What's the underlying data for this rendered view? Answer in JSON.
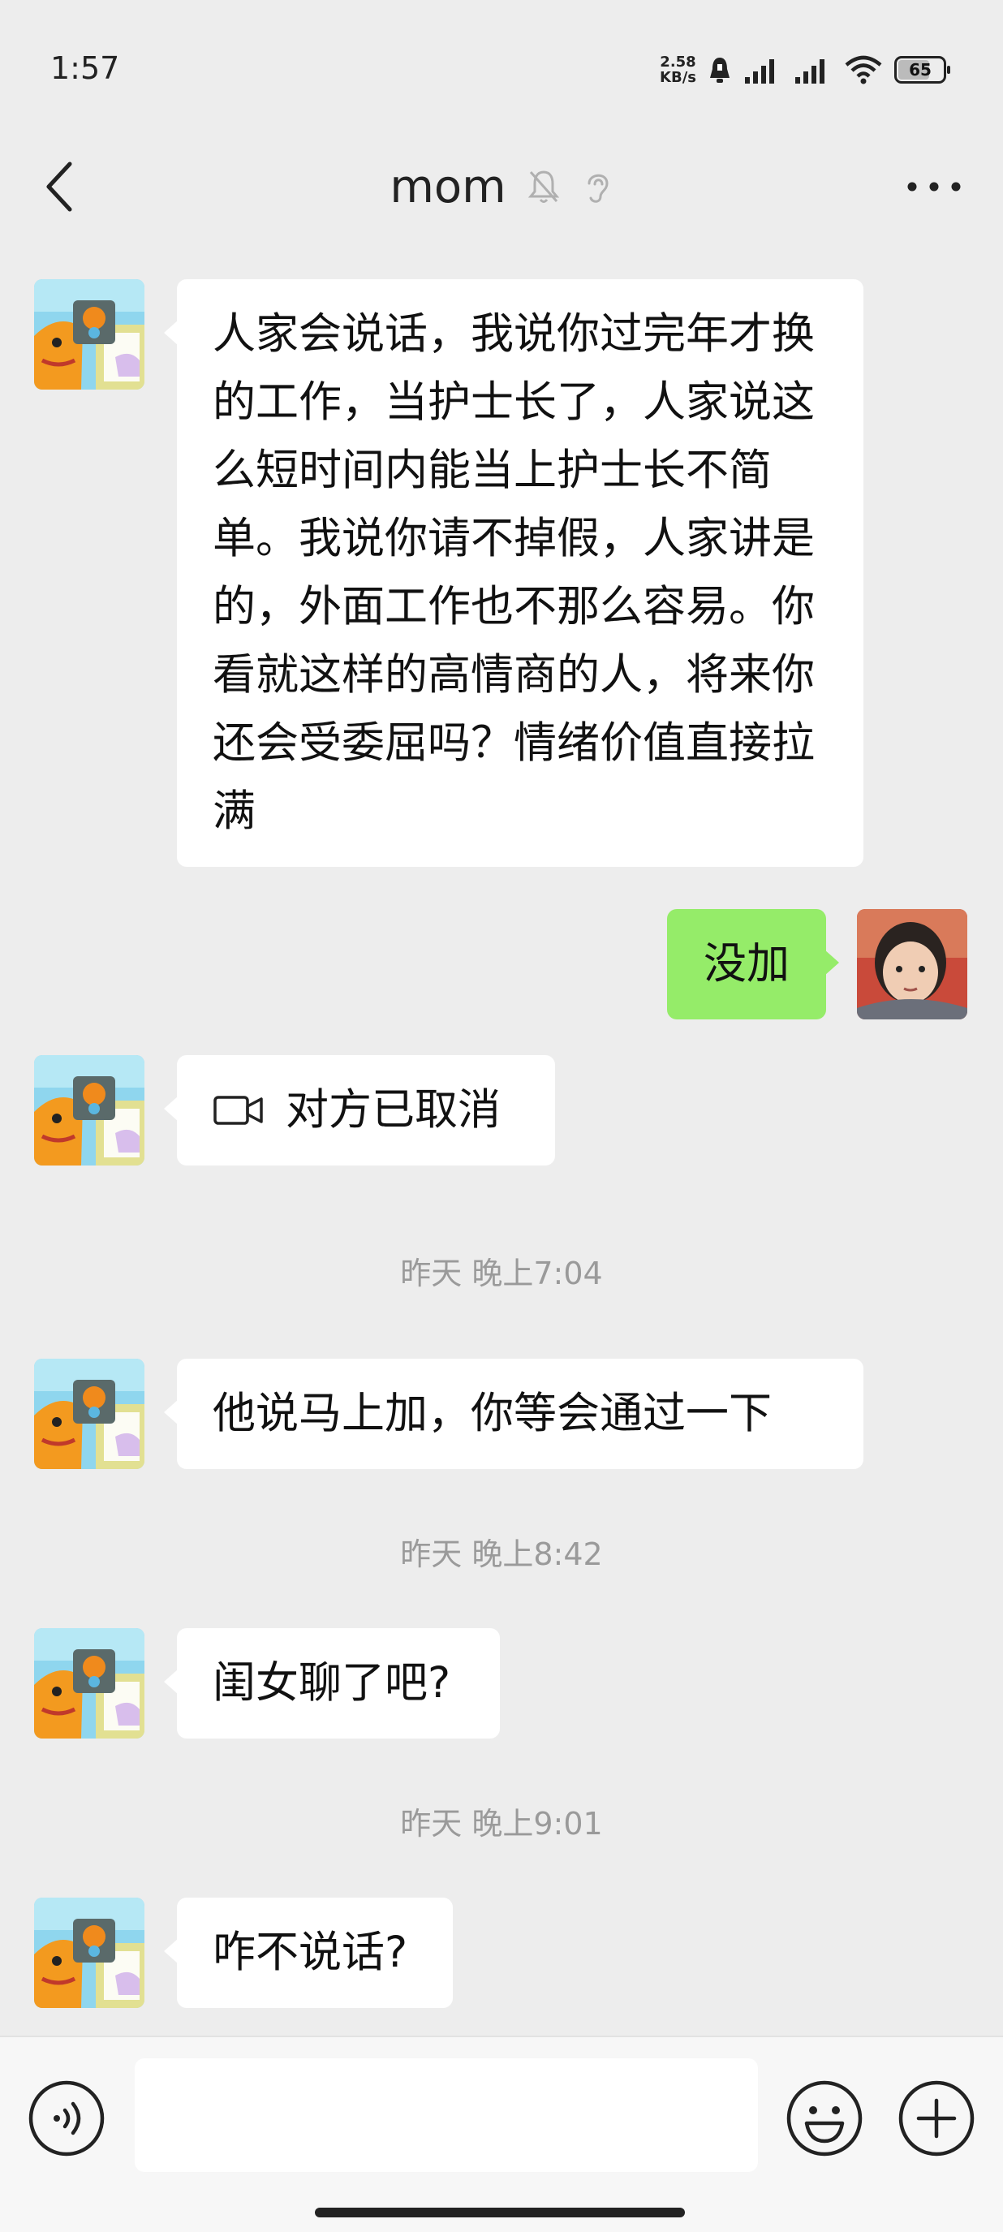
{
  "status_bar": {
    "time": "1:57",
    "net_speed_value": "2.58",
    "net_speed_unit": "KB/s",
    "battery_level": "65"
  },
  "header": {
    "title": "mom"
  },
  "messages": {
    "m1": "人家会说话，我说你过完年才换的工作，当护士长了，人家说这么短时间内能当上护士长不简单。我说你请不掉假，人家讲是的，外面工作也不那么容易。你看就这样的高情商的人，将来你还会受委屈吗？情绪价值直接拉满",
    "m2": "没加",
    "m3": "对方已取消",
    "t1": "昨天 晚上7:04",
    "m4": "他说马上加，你等会通过一下",
    "t2": "昨天 晚上8:42",
    "m5": "闺女聊了吧?",
    "t3": "昨天 晚上9:01",
    "m6": "咋不说话?"
  },
  "icons": {
    "back": "chevron-left-icon",
    "mute": "bell-off-icon",
    "earpiece": "ear-icon",
    "more": "more-dots-icon",
    "voice": "voice-icon",
    "emoji": "emoji-icon",
    "add": "plus-circle-icon",
    "video_call": "video-camera-icon"
  },
  "colors": {
    "background": "#ededed",
    "bubble_self": "#95ec69",
    "bubble_other": "#ffffff"
  }
}
